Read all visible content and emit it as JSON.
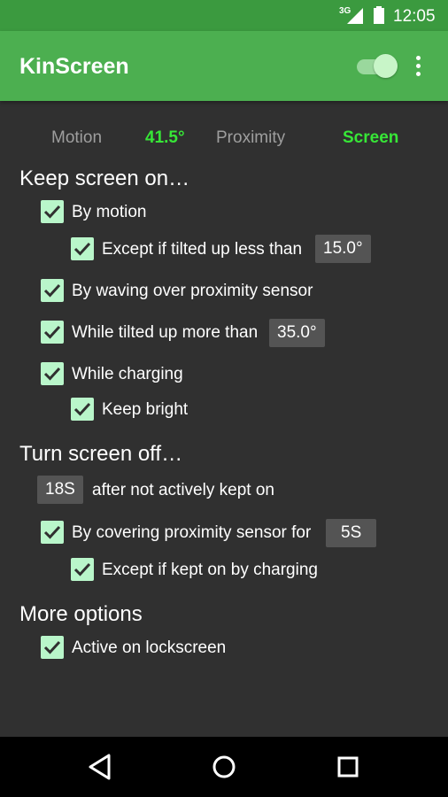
{
  "status_bar": {
    "network": "3G",
    "time": "12:05",
    "icons": [
      "signal-icon",
      "battery-icon"
    ]
  },
  "app_bar": {
    "title": "KinScreen",
    "toggle_on": true,
    "menu_icon": "overflow-menu-icon"
  },
  "readouts": [
    {
      "label": "Motion",
      "value": "41.5°"
    },
    {
      "label": "Proximity",
      "value": "Screen"
    }
  ],
  "keep_on": {
    "title": "Keep screen on…",
    "by_motion": {
      "label": "By motion",
      "checked": true
    },
    "except_tilted": {
      "label": "Except if tilted up less than",
      "checked": true,
      "value": "15.0°"
    },
    "by_waving": {
      "label": "By waving over proximity sensor",
      "checked": true
    },
    "while_tilted": {
      "label": "While tilted up more than",
      "checked": true,
      "value": "35.0°"
    },
    "while_charging": {
      "label": "While charging",
      "checked": true
    },
    "keep_bright": {
      "label": "Keep bright",
      "checked": true
    }
  },
  "turn_off": {
    "title": "Turn screen off…",
    "timeout": {
      "value": "18S",
      "label": "after not actively kept on"
    },
    "by_covering": {
      "label": "By covering proximity sensor for",
      "checked": true,
      "value": "5S"
    },
    "except_charging": {
      "label": "Except if kept on by charging",
      "checked": true
    }
  },
  "more": {
    "title": "More options",
    "lockscreen": {
      "label": "Active on lockscreen",
      "checked": true
    }
  },
  "colors": {
    "app_bar": "#4caf50",
    "status_bar": "#3b9a3f",
    "background": "#303030",
    "accent_value": "#37e637",
    "checkbox": "#b9f6ca",
    "chip": "#545454"
  },
  "nav": [
    "back-icon",
    "home-icon",
    "recents-icon"
  ]
}
